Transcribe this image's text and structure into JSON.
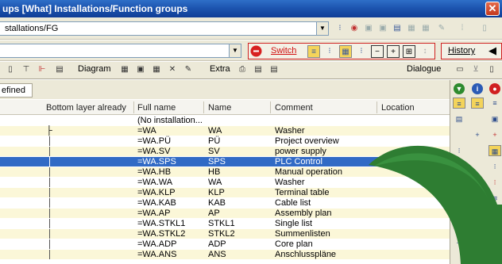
{
  "window": {
    "title": "ups [What] Installations/Function groups",
    "close_glyph": "✕"
  },
  "pathbar": {
    "path_value": "stallations/FG"
  },
  "toolbar2": {
    "switch_label": "Switch",
    "history_label": "History",
    "history_arrow": "◀"
  },
  "toolbar3": {
    "diagram_label": "Diagram",
    "extra_label": "Extra",
    "dialogue_label": "Dialogue"
  },
  "filter": {
    "tab_label": "efined"
  },
  "grid": {
    "columns": [
      "Bottom layer already",
      "Full name",
      "Name",
      "Comment",
      "Location"
    ],
    "rows": [
      {
        "full": "(No installation...",
        "name": "",
        "comment": ""
      },
      {
        "full": "=WA",
        "name": "WA",
        "comment": "Washer"
      },
      {
        "full": "=WA.PÜ",
        "name": "PÜ",
        "comment": "Project overview"
      },
      {
        "full": "=WA.SV",
        "name": "SV",
        "comment": "power supply"
      },
      {
        "full": "=WA.SPS",
        "name": "SPS",
        "comment": "PLC Control"
      },
      {
        "full": "=WA.HB",
        "name": "HB",
        "comment": "Manual operation"
      },
      {
        "full": "=WA.WA",
        "name": "WA",
        "comment": "Washer"
      },
      {
        "full": "=WA.KLP",
        "name": "KLP",
        "comment": "Terminal table"
      },
      {
        "full": "=WA.KAB",
        "name": "KAB",
        "comment": "Cable list"
      },
      {
        "full": "=WA.AP",
        "name": "AP",
        "comment": "Assembly plan"
      },
      {
        "full": "=WA.STKL1",
        "name": "STKL1",
        "comment": "Single list"
      },
      {
        "full": "=WA.STKL2",
        "name": "STKL2",
        "comment": "Summenlisten"
      },
      {
        "full": "=WA.ADP",
        "name": "ADP",
        "comment": "Core plan"
      },
      {
        "full": "=WA.ANS",
        "name": "ANS",
        "comment": "Anschlusspläne"
      }
    ]
  },
  "colors": {
    "selection": "#316ac5",
    "row_alt": "#fbf7d8",
    "accent_red": "#d01010",
    "arrow_green": "#2e7d32"
  }
}
